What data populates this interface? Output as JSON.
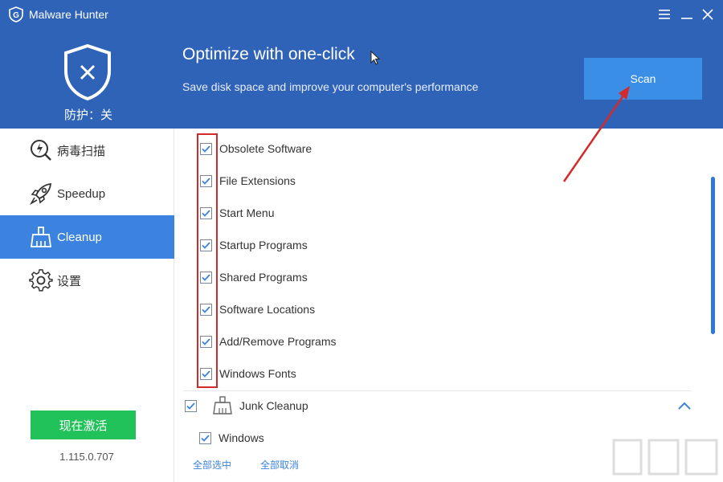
{
  "app": {
    "title": "Malware Hunter"
  },
  "header": {
    "status": "防护：关",
    "headline": "Optimize with one-click",
    "subline": "Save disk space and improve your computer's performance",
    "scan_label": "Scan"
  },
  "sidebar": {
    "items": [
      {
        "label": "病毒扫描",
        "icon": "virus-scan-icon"
      },
      {
        "label": "Speedup",
        "icon": "rocket-icon"
      },
      {
        "label": "Cleanup",
        "icon": "broom-icon",
        "active": true
      },
      {
        "label": "设置",
        "icon": "gear-icon"
      }
    ],
    "activate_label": "现在激活",
    "version": "1.115.0.707"
  },
  "content": {
    "registry_items": [
      "Obsolete Software",
      "File Extensions",
      "Start Menu",
      "Startup Programs",
      "Shared Programs",
      "Software Locations",
      "Add/Remove Programs",
      "Windows Fonts"
    ],
    "junk_section": {
      "label": "Junk Cleanup",
      "items": [
        "Windows"
      ]
    },
    "select_all": "全部选中",
    "deselect_all": "全部取消"
  },
  "colors": {
    "header_bg": "#2f63b8",
    "scan_button": "#3a8ee6",
    "active_nav": "#3b83df",
    "activate_button": "#22c25a",
    "highlight_box": "#d42a2a"
  }
}
